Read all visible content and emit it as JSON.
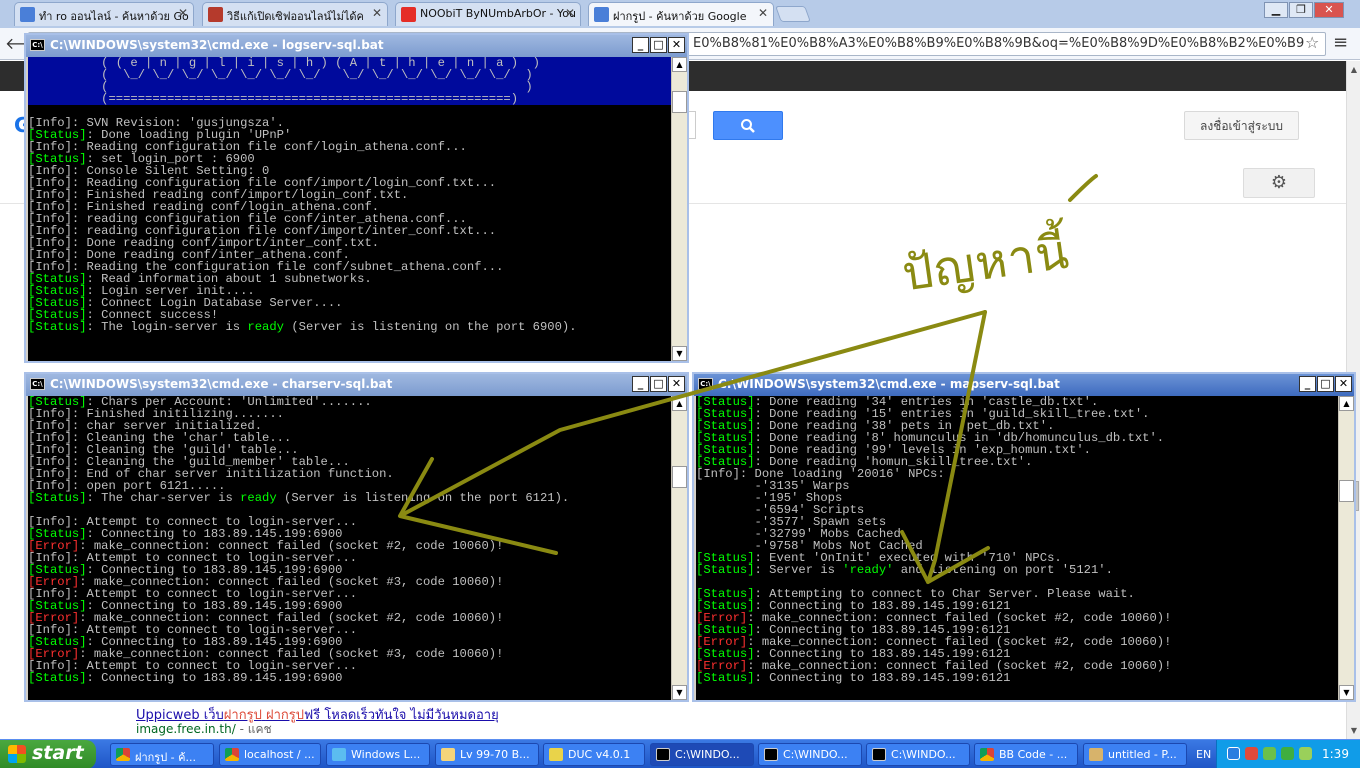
{
  "browser": {
    "tabs": [
      {
        "label": "ทำ ro ออนไลน์ - ค้นหาด้วย Go",
        "icon": "google-icon"
      },
      {
        "label": "วิธีแก้เปิดเซิฟออนไลน์ไม่ได้ค",
        "icon": "forum-icon"
      },
      {
        "label": "NOObiT ByNUmbArbOr - You",
        "icon": "youtube-icon"
      },
      {
        "label": "ฝากรูป - ค้นหาด้วย Google",
        "icon": "google-icon"
      }
    ],
    "address": "E0%B8%81%E0%B8%A3%E0%B8%B9%E0%B8%9B&oq=%E0%B8%9D%E0%B8%B2%E0%B9"
  },
  "google": {
    "signin_label": "ลงชื่อเข้าสู่ระบบ",
    "search_icon": "search-icon",
    "result_title_parts": [
      "Uppicweb เว็บ",
      "ฝากรูป",
      " ",
      "ฝากรูป",
      "ฟรี โหลดเร็วทันใจ ไม่มีวันหมดอายุ"
    ],
    "result_url": "image.free.in.th/",
    "result_url_suffix": " - แคช"
  },
  "windows": {
    "login": {
      "title": "C:\\WINDOWS\\system32\\cmd.exe - logserv-sql.bat",
      "banner": [
        "          ( ( e | n | g | l | i | s | h ) ( A | t | h | e | n | a )  )",
        "          (  \\_/ \\_/ \\_/ \\_/ \\_/ \\_/ \\_/   \\_/ \\_/ \\_/ \\_/ \\_/ \\_/  )",
        "          (                                                         )",
        "          (=======================================================)"
      ],
      "lines": [
        {
          "tag": "[Info]",
          "type": "info",
          "text": ": SVN Revision: 'gusjungsza'."
        },
        {
          "tag": "[Status]",
          "type": "status",
          "text": ": Done loading plugin 'UPnP'"
        },
        {
          "tag": "[Info]",
          "type": "info",
          "text": ": Reading configuration file conf/login_athena.conf..."
        },
        {
          "tag": "[Status]",
          "type": "status",
          "text": ": set login_port : 6900"
        },
        {
          "tag": "[Info]",
          "type": "info",
          "text": ": Console Silent Setting: 0"
        },
        {
          "tag": "[Info]",
          "type": "info",
          "text": ": Reading configuration file conf/import/login_conf.txt..."
        },
        {
          "tag": "[Info]",
          "type": "info",
          "text": ": Finished reading conf/import/login_conf.txt."
        },
        {
          "tag": "[Info]",
          "type": "info",
          "text": ": Finished reading conf/login_athena.conf."
        },
        {
          "tag": "[Info]",
          "type": "info",
          "text": ": reading configuration file conf/inter_athena.conf..."
        },
        {
          "tag": "[Info]",
          "type": "info",
          "text": ": reading configuration file conf/import/inter_conf.txt..."
        },
        {
          "tag": "[Info]",
          "type": "info",
          "text": ": Done reading conf/import/inter_conf.txt."
        },
        {
          "tag": "[Info]",
          "type": "info",
          "text": ": Done reading conf/inter_athena.conf."
        },
        {
          "tag": "[Info]",
          "type": "info",
          "text": ": Reading the configuration file conf/subnet_athena.conf..."
        },
        {
          "tag": "[Status]",
          "type": "status",
          "text": ": Read information about 1 subnetworks."
        },
        {
          "tag": "[Status]",
          "type": "status",
          "text": ": Login server init...."
        },
        {
          "tag": "[Status]",
          "type": "status",
          "text": ": Connect Login Database Server...."
        },
        {
          "tag": "[Status]",
          "type": "status",
          "text": ": Connect success!"
        },
        {
          "tag": "[Status]",
          "type": "status",
          "text": ": The login-server is ",
          "ready": "ready",
          "after": " (Server is listening on the port 6900)."
        }
      ]
    },
    "char": {
      "title": "C:\\WINDOWS\\system32\\cmd.exe - charserv-sql.bat",
      "lines": [
        {
          "tag": "[Status]",
          "type": "status",
          "text": ": Chars per Account: 'Unlimited'......."
        },
        {
          "tag": "[Info]",
          "type": "info",
          "text": ": Finished initilizing......."
        },
        {
          "tag": "[Info]",
          "type": "info",
          "text": ": char server initialized."
        },
        {
          "tag": "[Info]",
          "type": "info",
          "text": ": Cleaning the 'char' table..."
        },
        {
          "tag": "[Info]",
          "type": "info",
          "text": ": Cleaning the 'guild' table..."
        },
        {
          "tag": "[Info]",
          "type": "info",
          "text": ": Cleaning the 'guild_member' table..."
        },
        {
          "tag": "[Info]",
          "type": "info",
          "text": ": End of char server initilization function."
        },
        {
          "tag": "[Info]",
          "type": "info",
          "text": ": open port 6121....."
        },
        {
          "tag": "[Status]",
          "type": "status",
          "text": ": The char-server is ",
          "ready": "ready",
          "after": " (Server is listening on the port 6121)."
        },
        {
          "tag": "",
          "type": "blank",
          "text": ""
        },
        {
          "tag": "[Info]",
          "type": "info",
          "text": ": Attempt to connect to login-server..."
        },
        {
          "tag": "[Status]",
          "type": "status",
          "text": ": Connecting to 183.89.145.199:6900"
        },
        {
          "tag": "[Error]",
          "type": "error",
          "text": ": make_connection: connect failed (socket #2, code 10060)!"
        },
        {
          "tag": "[Info]",
          "type": "info",
          "text": ": Attempt to connect to login-server..."
        },
        {
          "tag": "[Status]",
          "type": "status",
          "text": ": Connecting to 183.89.145.199:6900"
        },
        {
          "tag": "[Error]",
          "type": "error",
          "text": ": make_connection: connect failed (socket #3, code 10060)!"
        },
        {
          "tag": "[Info]",
          "type": "info",
          "text": ": Attempt to connect to login-server..."
        },
        {
          "tag": "[Status]",
          "type": "status",
          "text": ": Connecting to 183.89.145.199:6900"
        },
        {
          "tag": "[Error]",
          "type": "error",
          "text": ": make_connection: connect failed (socket #2, code 10060)!"
        },
        {
          "tag": "[Info]",
          "type": "info",
          "text": ": Attempt to connect to login-server..."
        },
        {
          "tag": "[Status]",
          "type": "status",
          "text": ": Connecting to 183.89.145.199:6900"
        },
        {
          "tag": "[Error]",
          "type": "error",
          "text": ": make_connection: connect failed (socket #3, code 10060)!"
        },
        {
          "tag": "[Info]",
          "type": "info",
          "text": ": Attempt to connect to login-server..."
        },
        {
          "tag": "[Status]",
          "type": "status",
          "text": ": Connecting to 183.89.145.199:6900"
        }
      ]
    },
    "map": {
      "title": "C:\\WINDOWS\\system32\\cmd.exe - mapserv-sql.bat",
      "lines": [
        {
          "tag": "[Status]",
          "type": "status",
          "text": ": Done reading '34' entries in 'castle_db.txt'."
        },
        {
          "tag": "[Status]",
          "type": "status",
          "text": ": Done reading '15' entries in 'guild_skill_tree.txt'."
        },
        {
          "tag": "[Status]",
          "type": "status",
          "text": ": Done reading '38' pets in 'pet_db.txt'."
        },
        {
          "tag": "[Status]",
          "type": "status",
          "text": ": Done reading '8' homunculus in 'db/homunculus_db.txt'."
        },
        {
          "tag": "[Status]",
          "type": "status",
          "text": ": Done reading '99' levels in 'exp_homun.txt'."
        },
        {
          "tag": "[Status]",
          "type": "status",
          "text": ": Done reading 'homun_skill_tree.txt'."
        },
        {
          "tag": "[Info]",
          "type": "info",
          "text": ": Done loading '20016' NPCs:"
        },
        {
          "tag": "",
          "type": "plain",
          "text": "        -'3135' Warps"
        },
        {
          "tag": "",
          "type": "plain",
          "text": "        -'195' Shops"
        },
        {
          "tag": "",
          "type": "plain",
          "text": "        -'6594' Scripts"
        },
        {
          "tag": "",
          "type": "plain",
          "text": "        -'3577' Spawn sets"
        },
        {
          "tag": "",
          "type": "plain",
          "text": "        -'32799' Mobs Cached"
        },
        {
          "tag": "",
          "type": "plain",
          "text": "        -'9758' Mobs Not Cached"
        },
        {
          "tag": "[Status]",
          "type": "status",
          "text": ": Event 'OnInit' executed with '710' NPCs."
        },
        {
          "tag": "[Status]",
          "type": "status",
          "text": ": Server is ",
          "ready": "'ready'",
          "after": " and listening on port '5121'."
        },
        {
          "tag": "",
          "type": "blank",
          "text": ""
        },
        {
          "tag": "[Status]",
          "type": "status",
          "text": ": Attempting to connect to Char Server. Please wait."
        },
        {
          "tag": "[Status]",
          "type": "status",
          "text": ": Connecting to 183.89.145.199:6121"
        },
        {
          "tag": "[Error]",
          "type": "error",
          "text": ": make_connection: connect failed (socket #2, code 10060)!"
        },
        {
          "tag": "[Status]",
          "type": "status",
          "text": ": Connecting to 183.89.145.199:6121"
        },
        {
          "tag": "[Error]",
          "type": "error",
          "text": ": make_connection: connect failed (socket #2, code 10060)!"
        },
        {
          "tag": "[Status]",
          "type": "status",
          "text": ": Connecting to 183.89.145.199:6121"
        },
        {
          "tag": "[Error]",
          "type": "error",
          "text": ": make_connection: connect failed (socket #2, code 10060)!"
        },
        {
          "tag": "[Status]",
          "type": "status",
          "text": ": Connecting to 183.89.145.199:6121"
        }
      ]
    }
  },
  "annotation": {
    "text": "ปัญหานี้",
    "color": "#8a8a12"
  },
  "taskbar": {
    "start_label": "start",
    "items": [
      {
        "label": "ฝากรูป - ค้...",
        "icon": "chrome-icon",
        "pressed": false
      },
      {
        "label": "localhost / ...",
        "icon": "chrome-icon",
        "pressed": false
      },
      {
        "label": "Windows L...",
        "icon": "windows-live-icon",
        "pressed": false
      },
      {
        "label": "Lv 99-70 B...",
        "icon": "folder-icon",
        "pressed": false
      },
      {
        "label": "DUC v4.0.1",
        "icon": "duc-icon",
        "pressed": false
      },
      {
        "label": "C:\\WINDO...",
        "icon": "cmd-icon",
        "pressed": true
      },
      {
        "label": "C:\\WINDO...",
        "icon": "cmd-icon",
        "pressed": false
      },
      {
        "label": "C:\\WINDO...",
        "icon": "cmd-icon",
        "pressed": false
      },
      {
        "label": "BB Code - ...",
        "icon": "chrome-icon",
        "pressed": false
      },
      {
        "label": "untitled - P...",
        "icon": "paint-icon",
        "pressed": false
      }
    ],
    "language": "EN",
    "clock": "1:39"
  },
  "colors": {
    "status_tag": "#00ff00",
    "error_tag": "#ff3030",
    "console_text": "#c0c0c0",
    "console_bg": "#000000",
    "banner_bg": "#000a9c",
    "taskbar": "#245edb",
    "google_blue_button": "#4d90fe"
  }
}
